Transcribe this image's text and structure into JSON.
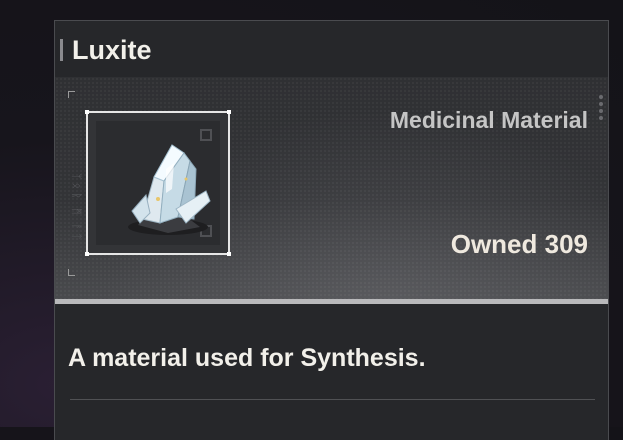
{
  "item": {
    "name": "Luxite",
    "type": "Medicinal Material",
    "owned_text": "Owned 309",
    "description": "A material used for Synthesis.",
    "icon": "crystal-cluster-icon"
  },
  "colors": {
    "panel_bg": "#26272a",
    "title_text": "#f2f0ea",
    "accent_line": "#b9b9bb"
  }
}
